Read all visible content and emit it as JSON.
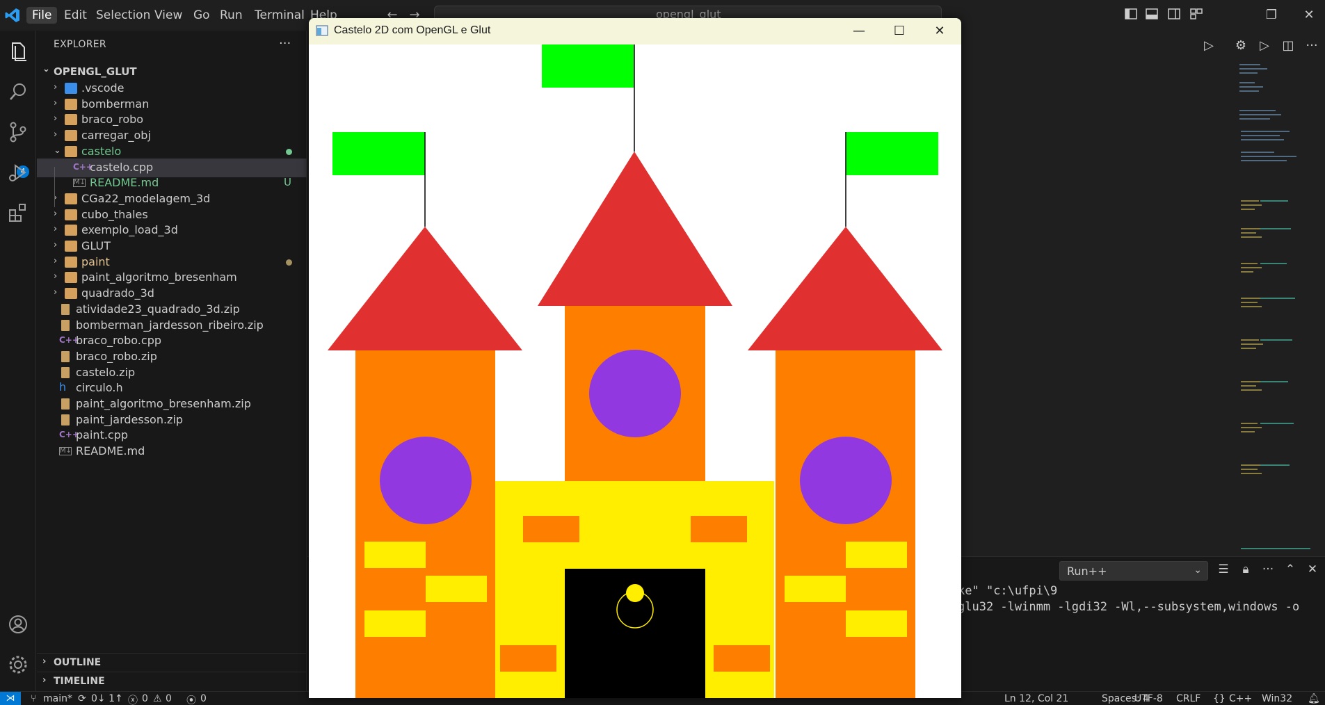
{
  "menu": [
    "File",
    "Edit",
    "Selection",
    "View",
    "Go",
    "Run",
    "Terminal",
    "Help"
  ],
  "search": {
    "text": "opengl_glut"
  },
  "activity": {
    "source_control_badge": "4"
  },
  "explorer": {
    "title": "EXPLORER",
    "root": "OPENGL_GLUT",
    "items": [
      {
        "label": ".vscode",
        "type": "folder",
        "color": "#cccccc"
      },
      {
        "label": "bomberman",
        "type": "folder",
        "color": "#cccccc"
      },
      {
        "label": "braco_robo",
        "type": "folder",
        "color": "#cccccc"
      },
      {
        "label": "carregar_obj",
        "type": "folder",
        "color": "#cccccc"
      },
      {
        "label": "castelo",
        "type": "folder-open",
        "color": "#73c991"
      },
      {
        "label": "castelo.cpp",
        "type": "cpp",
        "color": "#cccccc"
      },
      {
        "label": "README.md",
        "type": "md",
        "color": "#73c991",
        "status": "U"
      },
      {
        "label": "CGa22_modelagem_3d",
        "type": "folder",
        "color": "#cccccc"
      },
      {
        "label": "cubo_thales",
        "type": "folder",
        "color": "#cccccc"
      },
      {
        "label": "exemplo_load_3d",
        "type": "folder",
        "color": "#cccccc"
      },
      {
        "label": "GLUT",
        "type": "folder",
        "color": "#cccccc"
      },
      {
        "label": "paint",
        "type": "folder",
        "color": "#e2c08d"
      },
      {
        "label": "paint_algoritmo_bresenham",
        "type": "folder",
        "color": "#cccccc"
      },
      {
        "label": "quadrado_3d",
        "type": "folder",
        "color": "#cccccc"
      },
      {
        "label": "atividade23_quadrado_3d.zip",
        "type": "zip",
        "color": "#cccccc"
      },
      {
        "label": "bomberman_jardesson_ribeiro.zip",
        "type": "zip",
        "color": "#cccccc"
      },
      {
        "label": "braco_robo.cpp",
        "type": "cpp",
        "color": "#cccccc"
      },
      {
        "label": "braco_robo.zip",
        "type": "zip",
        "color": "#cccccc"
      },
      {
        "label": "castelo.zip",
        "type": "zip",
        "color": "#cccccc"
      },
      {
        "label": "circulo.h",
        "type": "h",
        "color": "#cccccc"
      },
      {
        "label": "paint_algoritmo_bresenham.zip",
        "type": "zip",
        "color": "#cccccc"
      },
      {
        "label": "paint_jardesson.zip",
        "type": "zip",
        "color": "#cccccc"
      },
      {
        "label": "paint.cpp",
        "type": "cpp",
        "color": "#cccccc"
      },
      {
        "label": "README.md",
        "type": "md",
        "color": "#cccccc"
      }
    ],
    "outline": "OUTLINE",
    "timeline": "TIMELINE"
  },
  "panel": {
    "run_select": "Run++",
    "terminal_line1": "ke\" \"c:\\ufpi\\9",
    "terminal_line2": "glu32 -lwinmm -lgdi32 -Wl,--subsystem,windows -o"
  },
  "glwindow": {
    "title": "Castelo 2D com OpenGL e Glut",
    "colors": {
      "background": "#ffffff",
      "wall": "#fe7f00",
      "roof": "#e03030",
      "window": "#9238e0",
      "flag": "#00ff00",
      "yellow": "#ffee00",
      "door": "#000000"
    }
  },
  "statusbar": {
    "branch": "main*",
    "sync": "0↓ 1↑",
    "errors": "0",
    "warnings": "0",
    "ports": "0",
    "position": "Ln 12, Col 21",
    "spaces": "Spaces: 4",
    "encoding": "UTF-8",
    "eol": "CRLF",
    "language": "C++",
    "platform": "Win32"
  }
}
